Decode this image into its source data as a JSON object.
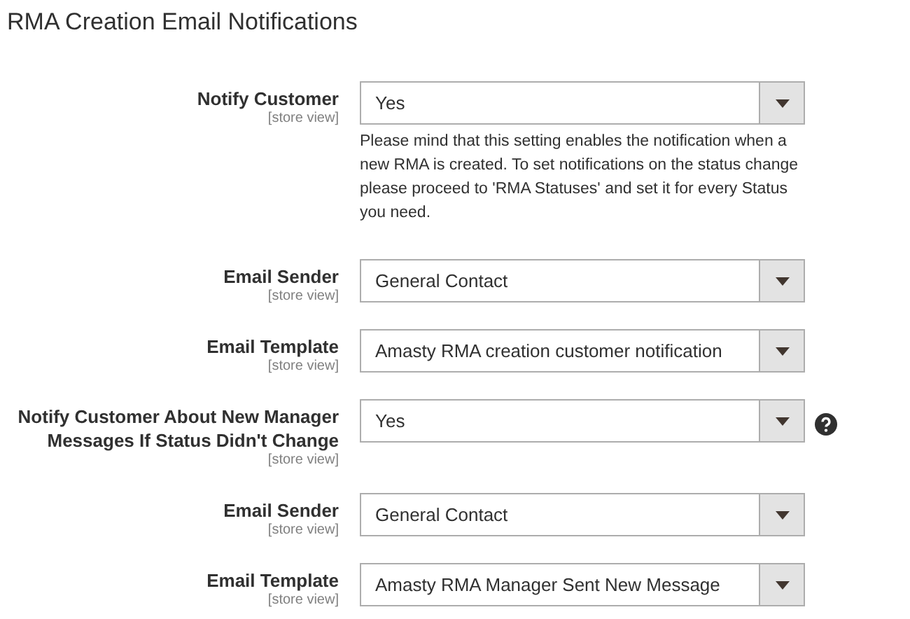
{
  "section_title": "RMA Creation Email Notifications",
  "fields": [
    {
      "label": "Notify Customer",
      "scope": "[store view]",
      "value": "Yes",
      "note": "Please mind that this setting enables the notification when a new RMA is created. To set notifications on the status change please proceed to 'RMA Statuses' and set it for every Status you need.",
      "help_icon": false
    },
    {
      "label": "Email Sender",
      "scope": "[store view]",
      "value": "General Contact",
      "help_icon": false
    },
    {
      "label": "Email Template",
      "scope": "[store view]",
      "value": "Amasty RMA creation customer notification",
      "help_icon": false
    },
    {
      "label": "Notify Customer About New Manager Messages If Status Didn't Change",
      "scope": "[store view]",
      "value": "Yes",
      "help_icon": true
    },
    {
      "label": "Email Sender",
      "scope": "[store view]",
      "value": "General Contact",
      "help_icon": false
    },
    {
      "label": "Email Template",
      "scope": "[store view]",
      "value": "Amasty RMA Manager Sent New Message",
      "help_icon": false
    }
  ]
}
